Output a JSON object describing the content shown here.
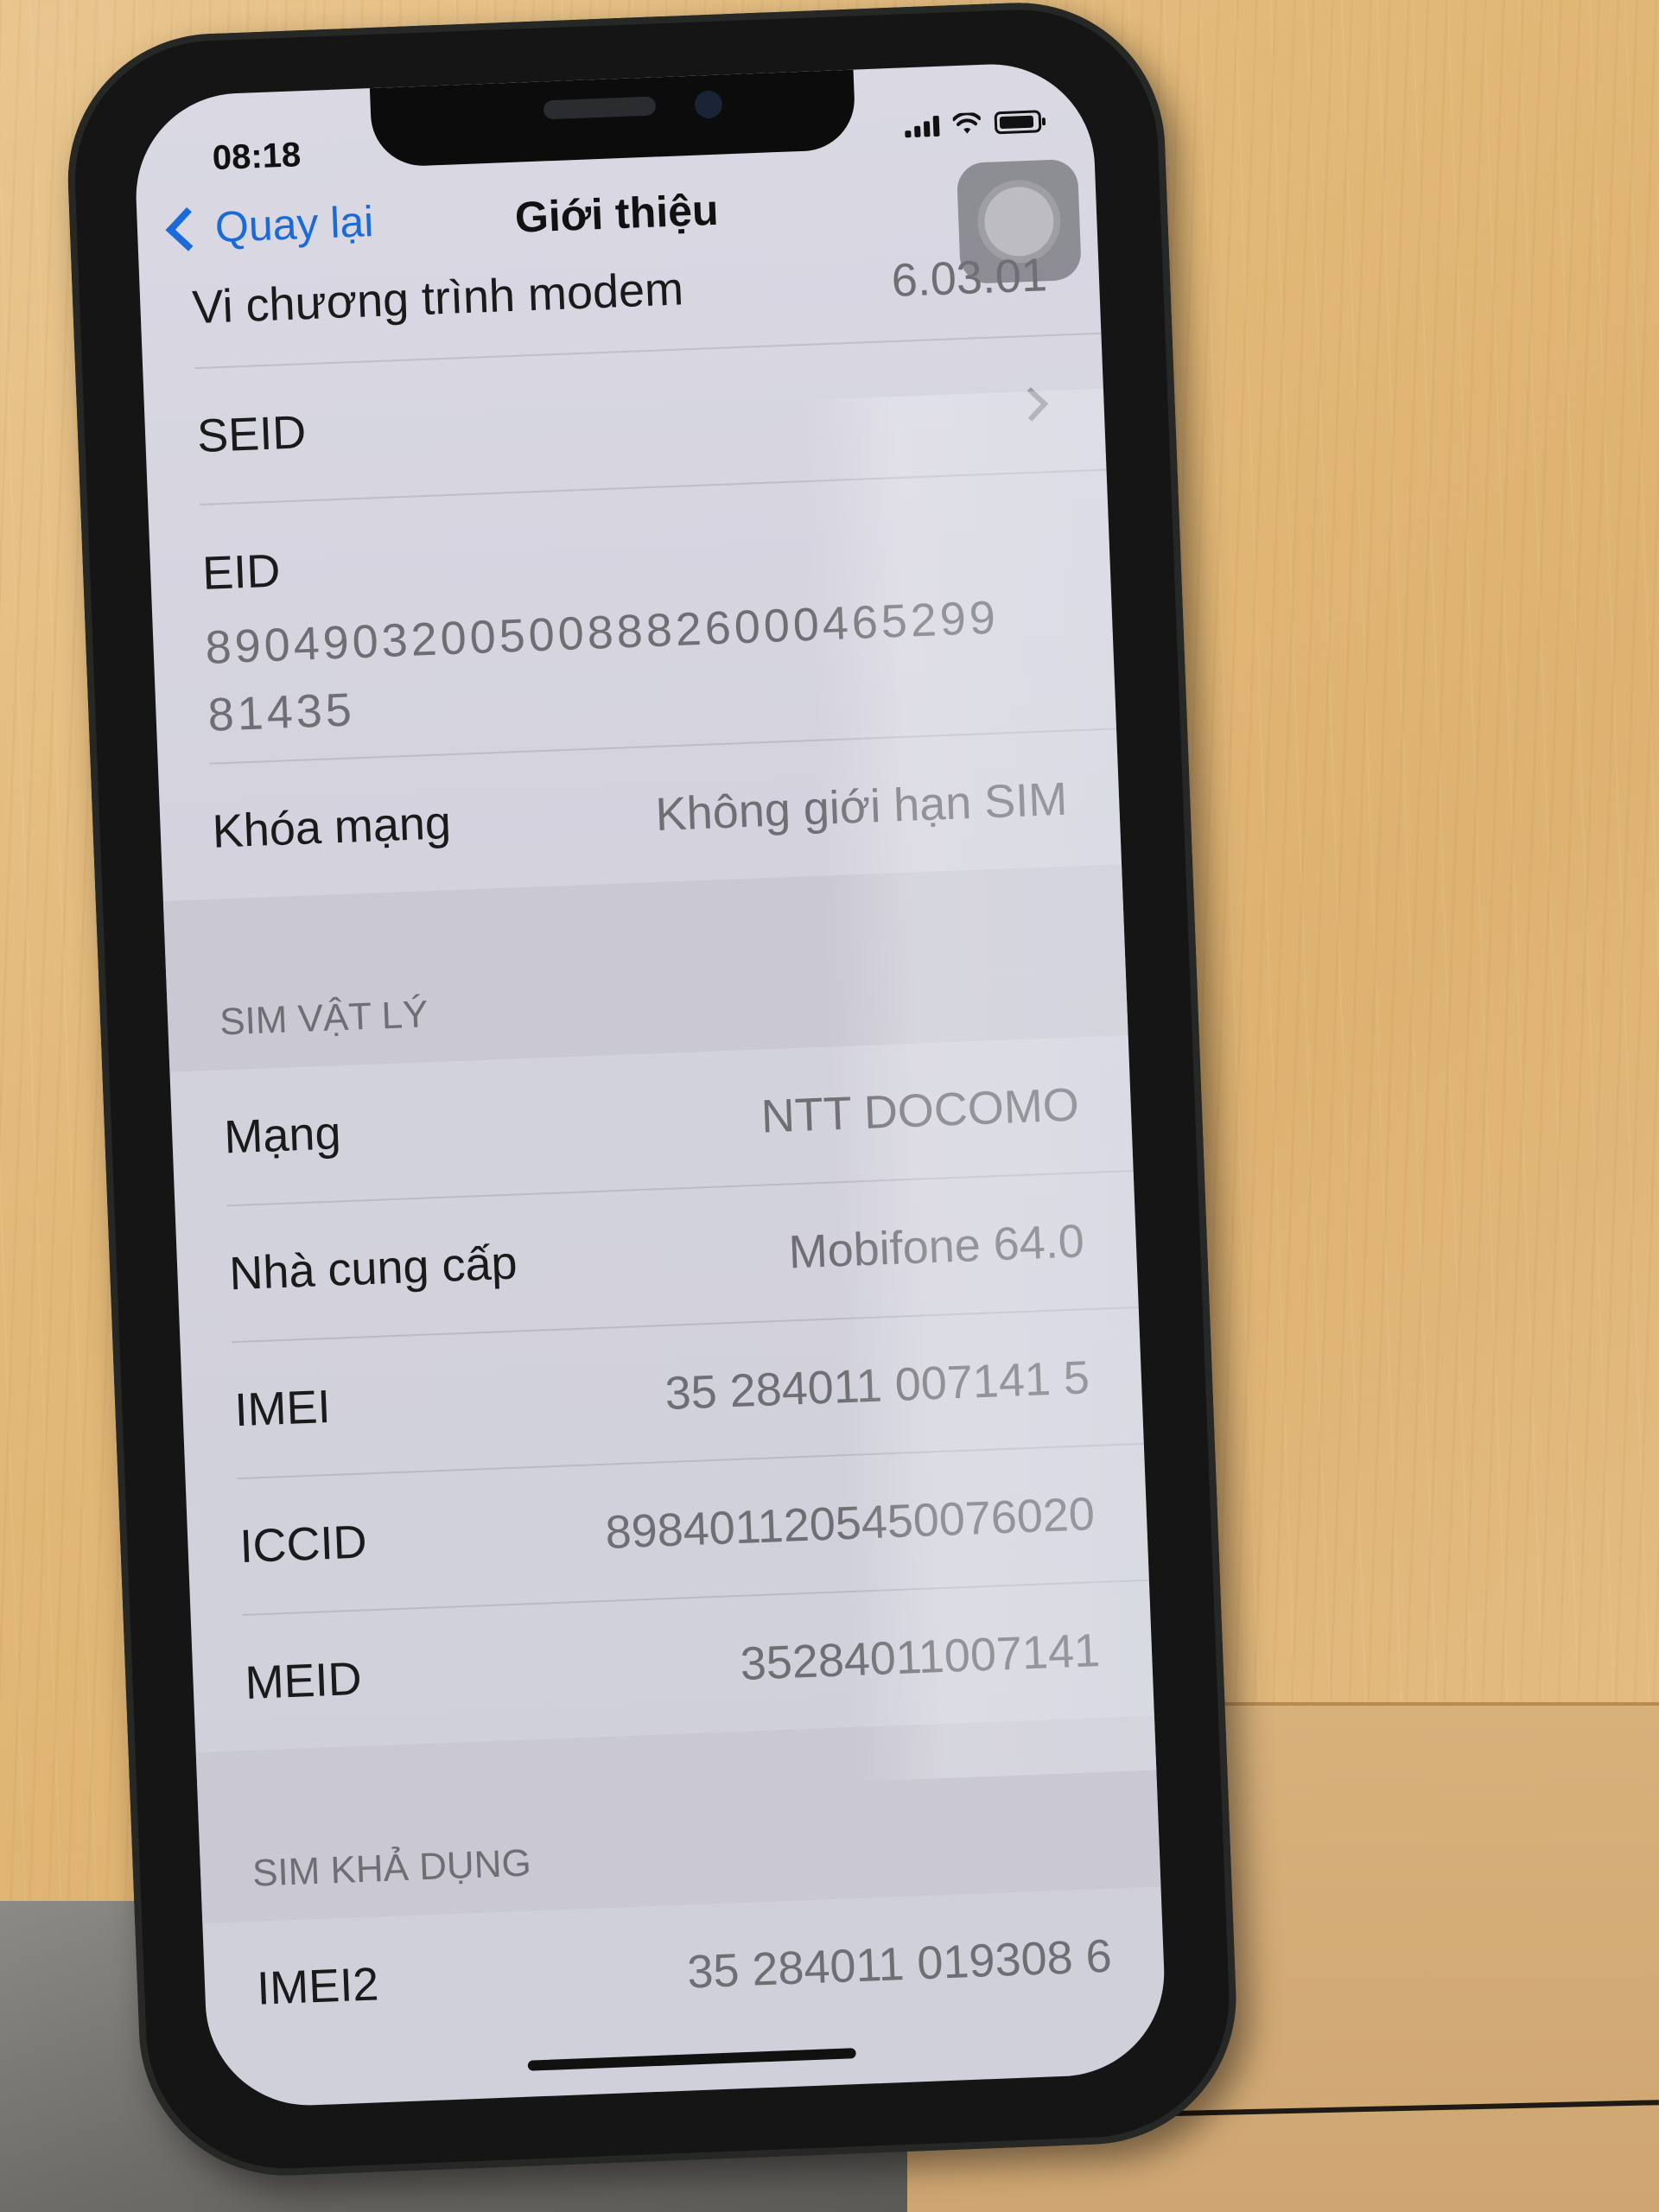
{
  "status_bar": {
    "time": "08:18",
    "icons": [
      "cellular-signal-icon",
      "wifi-icon",
      "battery-icon"
    ]
  },
  "nav": {
    "back_label": "Quay lại",
    "title": "Giới thiệu"
  },
  "rows_top": [
    {
      "label": "Vi chương trình modem",
      "value": "6.03.01"
    },
    {
      "label": "SEID",
      "value": ""
    },
    {
      "label": "EID",
      "value": "8904903200500888260004652998 1435"
    },
    {
      "label": "Khóa mạng",
      "value": "Không giới hạn SIM"
    }
  ],
  "eid_lines": [
    "890490320050088826000465299",
    "81435"
  ],
  "sections": {
    "physical_sim": "SIM VẬT LÝ",
    "available_sim": "SIM KHẢ DỤNG"
  },
  "physical_sim_rows": [
    {
      "label": "Mạng",
      "value": "NTT DOCOMO"
    },
    {
      "label": "Nhà cung cấp",
      "value": "Mobifone 64.0"
    },
    {
      "label": "IMEI",
      "value": "35 284011 007141 5"
    },
    {
      "label": "ICCID",
      "value": "8984011205450076020"
    },
    {
      "label": "MEID",
      "value": "35284011007141"
    }
  ],
  "available_sim_rows": [
    {
      "label": "IMEI2",
      "value": "35 284011 019308 6"
    }
  ],
  "colors": {
    "accent": "#1a6bd9",
    "screen_bg": "#d3d2dd",
    "section_bg": "#c9c8d3",
    "secondary_text": "#6e6e73"
  }
}
